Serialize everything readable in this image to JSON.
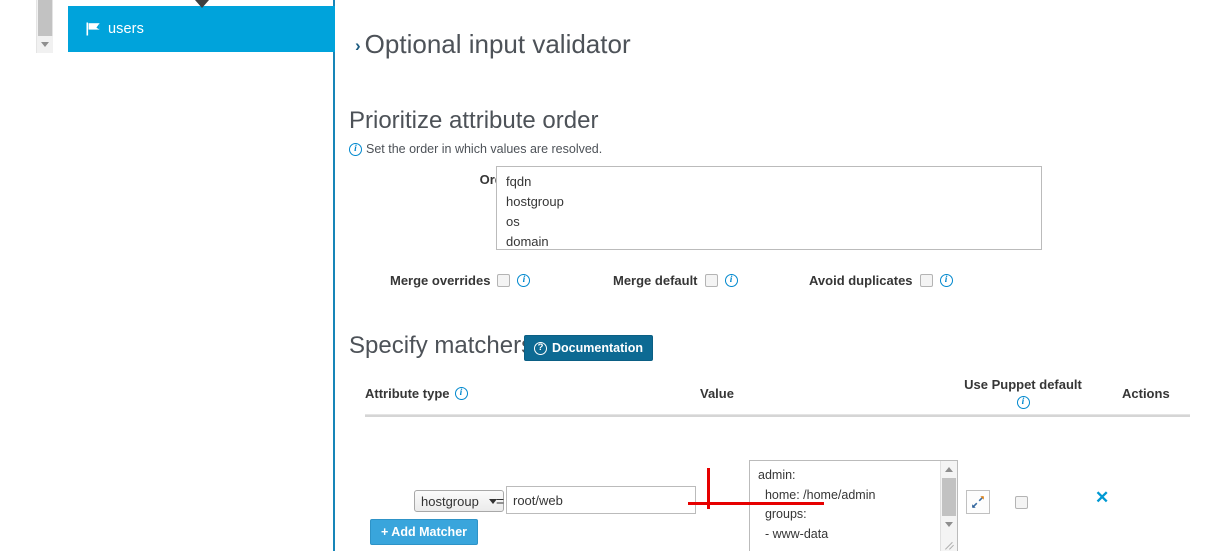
{
  "sidebar": {
    "scrollbar": {
      "name": "vertical-scrollbar"
    },
    "items": [
      {
        "icon": "flag-icon",
        "label": "users",
        "selected": true
      }
    ]
  },
  "content": {
    "collapsible_section": {
      "chevron": "›",
      "title": "Optional input validator"
    },
    "prioritize": {
      "title": "Prioritize attribute order",
      "help_text": "Set the order in which values are resolved.",
      "order_label": "Order",
      "order_value": "fqdn\nhostgroup\nos\ndomain",
      "checkboxes": [
        {
          "label": "Merge overrides",
          "checked": false
        },
        {
          "label": "Merge default",
          "checked": false
        },
        {
          "label": "Avoid duplicates",
          "checked": false
        }
      ]
    },
    "matchers": {
      "title": "Specify matchers",
      "documentation_button": "Documentation",
      "columns": {
        "attribute_type": "Attribute type",
        "value": "Value",
        "use_puppet_default": "Use Puppet default",
        "actions": "Actions"
      },
      "rows": [
        {
          "attribute_type": "hostgroup",
          "operator": "=",
          "attribute_value": "root/web",
          "value": "admin:\n  home: /home/admin\n  groups:\n  - www-data",
          "use_puppet_default": false,
          "delete_icon": "✕"
        }
      ],
      "add_button": "+ Add Matcher"
    }
  },
  "colors": {
    "accent_blue": "#00a3db",
    "button_blue": "#39a5dc",
    "doc_button_blue": "#0d6a93",
    "info_icon_blue": "#0088ce",
    "annotation_red": "#e60000",
    "text_dark": "#363636",
    "heading_gray": "#4d5258"
  }
}
